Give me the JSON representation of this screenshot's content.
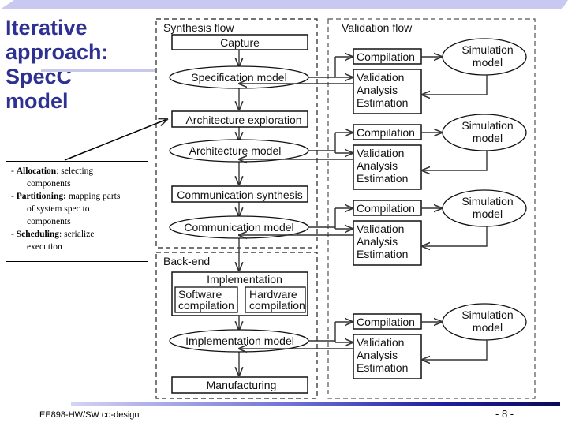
{
  "slide": {
    "title_lines": [
      "Iterative",
      "approach:",
      "SpecC",
      "model"
    ],
    "footer_left": "EE898-HW/SW co-design",
    "footer_right": "- 8 -",
    "colors": {
      "title": "#2e3192",
      "band_light": "#c8c8f0",
      "band_dark": "#0a0a6a"
    }
  },
  "note": {
    "items": [
      {
        "term": "Allocation",
        "sep": ": ",
        "text": "selecting",
        "cont": [
          "components"
        ]
      },
      {
        "term": "Partitioning:",
        "sep": " ",
        "text": "mapping parts",
        "cont": [
          "of system spec to",
          "components"
        ]
      },
      {
        "term": "Scheduling",
        "sep": ": ",
        "text": "serialize",
        "cont": [
          "execution"
        ]
      }
    ]
  },
  "diagram": {
    "synthesis_label": "Synthesis flow",
    "validation_label": "Validation flow",
    "backend_label": "Back-end",
    "capture": "Capture",
    "specification_model": "Specification model",
    "architecture_exploration": "Architecture exploration",
    "architecture_model": "Architecture model",
    "communication_synthesis": "Communication synthesis",
    "communication_model": "Communication model",
    "implementation": "Implementation",
    "software_compilation": [
      "Software",
      "compilation"
    ],
    "hardware_compilation": [
      "Hardware",
      "compilation"
    ],
    "implementation_model": "Implementation model",
    "manufacturing": "Manufacturing",
    "validation_units": [
      {
        "compilation": "Compilation",
        "sim_model": [
          "Simulation",
          "model"
        ],
        "vae": [
          "Validation",
          "Analysis",
          "Estimation"
        ]
      },
      {
        "compilation": "Compilation",
        "sim_model": [
          "Simulation",
          "model"
        ],
        "vae": [
          "Validation",
          "Analysis",
          "Estimation"
        ]
      },
      {
        "compilation": "Compilation",
        "sim_model": [
          "Simulation",
          "model"
        ],
        "vae": [
          "Validation",
          "Analysis",
          "Estimation"
        ]
      },
      {
        "compilation": "Compilation",
        "sim_model": [
          "Simulation",
          "model"
        ],
        "vae": [
          "Validation",
          "Analysis",
          "Estimation"
        ]
      }
    ]
  }
}
